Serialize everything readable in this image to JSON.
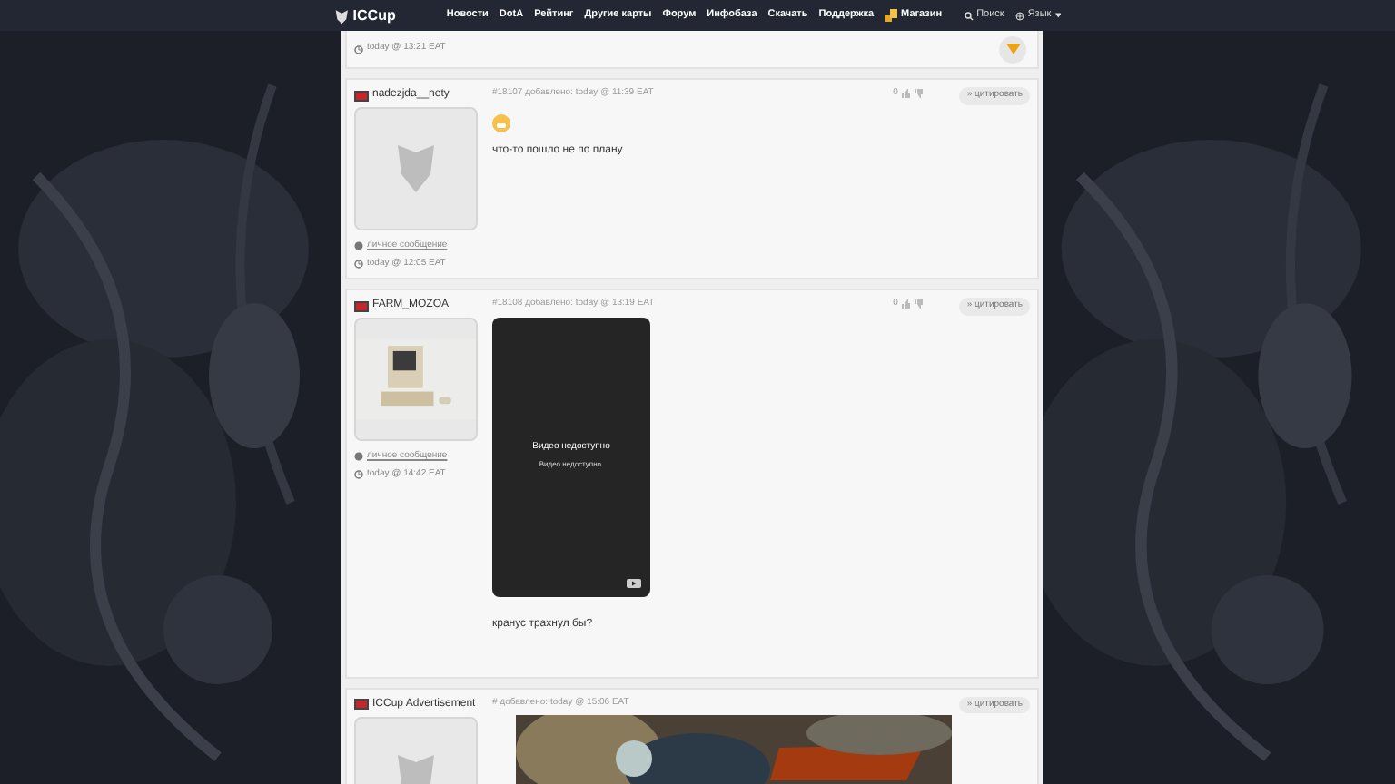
{
  "nav": {
    "logo": "ICCup",
    "items": [
      "Новости",
      "DotA",
      "Рейтинг",
      "Другие карты",
      "Форум",
      "Инфобаза",
      "Скачать",
      "Поддержка",
      "Магазин"
    ],
    "search": "Поиск",
    "language": "Язык"
  },
  "top_post": {
    "time": "today @ 13:21 EAT"
  },
  "posts": [
    {
      "kind": "text",
      "author": "nadezjda__nety",
      "meta": "#18107 добавлено: today @ 11:39 EAT",
      "votes": "0",
      "quote": "» цитировать",
      "avatar": {
        "kind": "emblem"
      },
      "pm": "личное сообщение",
      "time": "today @ 12:05 EAT",
      "emoji": true,
      "text": "что-то пошло не по плану"
    },
    {
      "kind": "video",
      "author": "FARM_MOZOA",
      "meta": "#18108 добавлено: today @ 13:19 EAT",
      "votes": "0",
      "quote": "» цитировать",
      "pm": "личное сообщение",
      "time": "today @ 14:42 EAT",
      "video_title": "Видео недоступно",
      "video_sub": "Видео недоступно.",
      "text": "кранус трахнул бы?"
    },
    {
      "kind": "ad",
      "author": "ICCup Advertisement",
      "meta": "# добавлено: today @ 15:06 EAT",
      "quote": "» цитировать",
      "avatar": {
        "kind": "emblem"
      }
    }
  ]
}
